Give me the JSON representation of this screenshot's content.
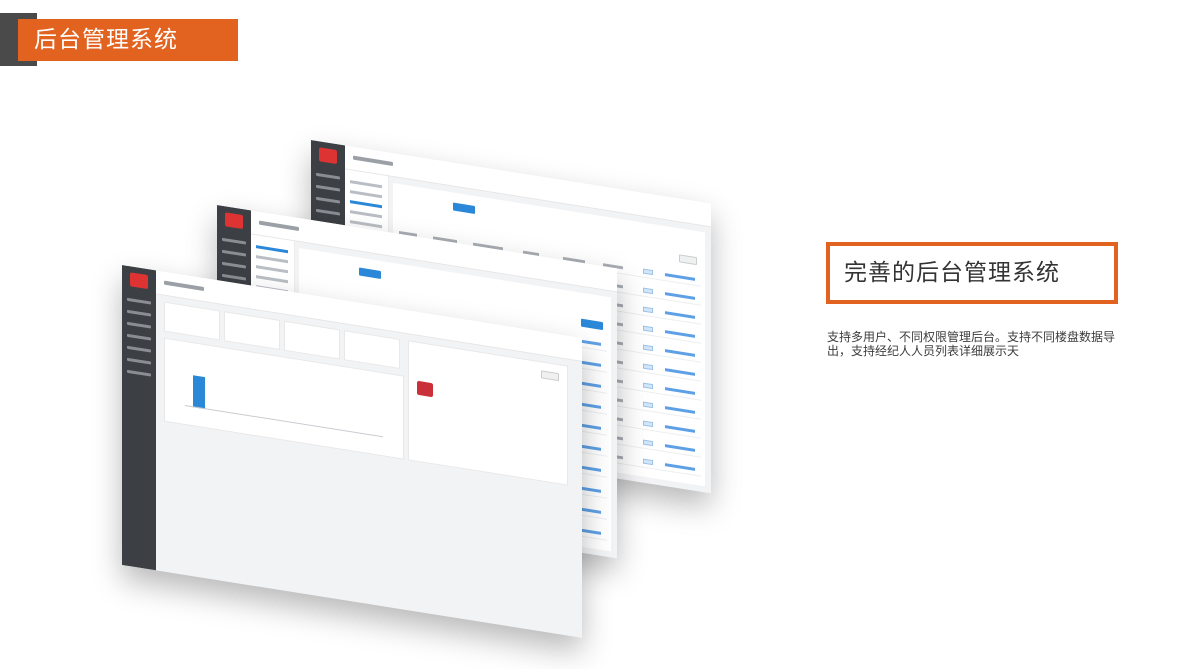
{
  "header": {
    "title": "后台管理系统"
  },
  "feature": {
    "caption": "完善的后台管理系统",
    "description": "支持多用户、不同权限管理后台。支持不同楼盘数据导出，支持经纪人人员列表详细展示天"
  },
  "colors": {
    "accent": "#e2621f",
    "dark": "#4a4a4a",
    "ui_blue": "#2b88d8",
    "ui_sidebar": "#3c3f44"
  }
}
